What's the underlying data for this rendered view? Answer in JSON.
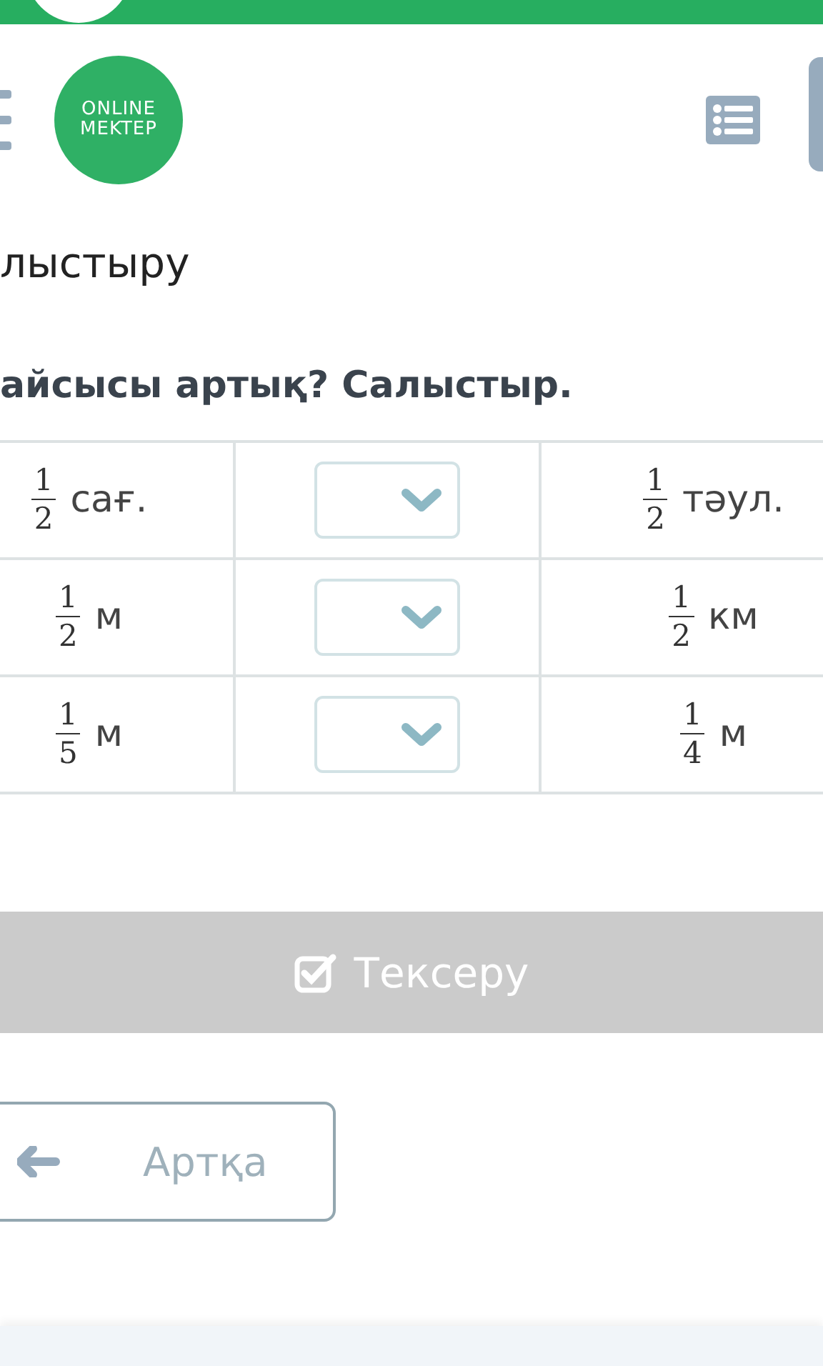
{
  "header": {
    "logo": [
      "ONLINE",
      "MEKTEP"
    ]
  },
  "title": "лыстыру",
  "question": "айсысы артық? Салыстыр.",
  "rows": [
    {
      "left": {
        "numerator": "1",
        "denominator": "2",
        "unit": "сағ."
      },
      "right": {
        "numerator": "1",
        "denominator": "2",
        "unit": "тәул."
      }
    },
    {
      "left": {
        "numerator": "1",
        "denominator": "2",
        "unit": "м"
      },
      "right": {
        "numerator": "1",
        "denominator": "2",
        "unit": "км"
      }
    },
    {
      "left": {
        "numerator": "1",
        "denominator": "5",
        "unit": "м"
      },
      "right": {
        "numerator": "1",
        "denominator": "4",
        "unit": "м"
      }
    }
  ],
  "check_button": "Тексеру",
  "back_button": "Артқа"
}
